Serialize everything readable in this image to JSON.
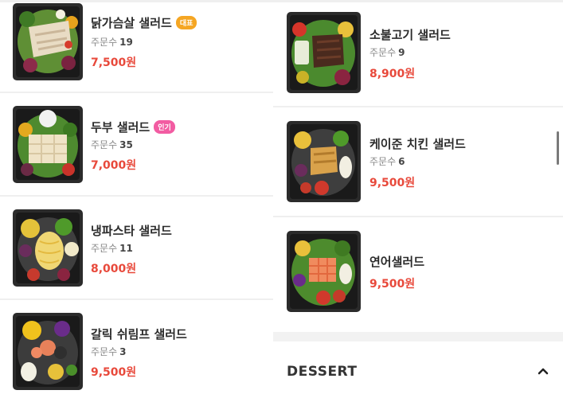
{
  "left_items": [
    {
      "name": "닭가슴살 샐러드",
      "badge": "대표",
      "orders_label": "주문수",
      "orders": "19",
      "price": "7,500원"
    },
    {
      "name": "두부 샐러드",
      "badge": "인기",
      "orders_label": "주문수",
      "orders": "35",
      "price": "7,000원"
    },
    {
      "name": "냉파스타 샐러드",
      "orders_label": "주문수",
      "orders": "11",
      "price": "8,000원"
    },
    {
      "name": "갈릭 쉬림프 샐러드",
      "orders_label": "주문수",
      "orders": "3",
      "price": "9,500원"
    }
  ],
  "right_items": [
    {
      "name": "소불고기 샐러드",
      "orders_label": "주문수",
      "orders": "9",
      "price": "8,900원"
    },
    {
      "name": "케이준 치킨 샐러드",
      "orders_label": "주문수",
      "orders": "6",
      "price": "9,500원"
    },
    {
      "name": "연어샐러드",
      "price": "9,500원"
    }
  ],
  "section": {
    "title": "DESSERT",
    "toggle_icon": "chevron-up-icon"
  },
  "colors": {
    "price": "#e8493b",
    "badge_main": "#f5a623",
    "badge_popular": "#f25ca2"
  }
}
